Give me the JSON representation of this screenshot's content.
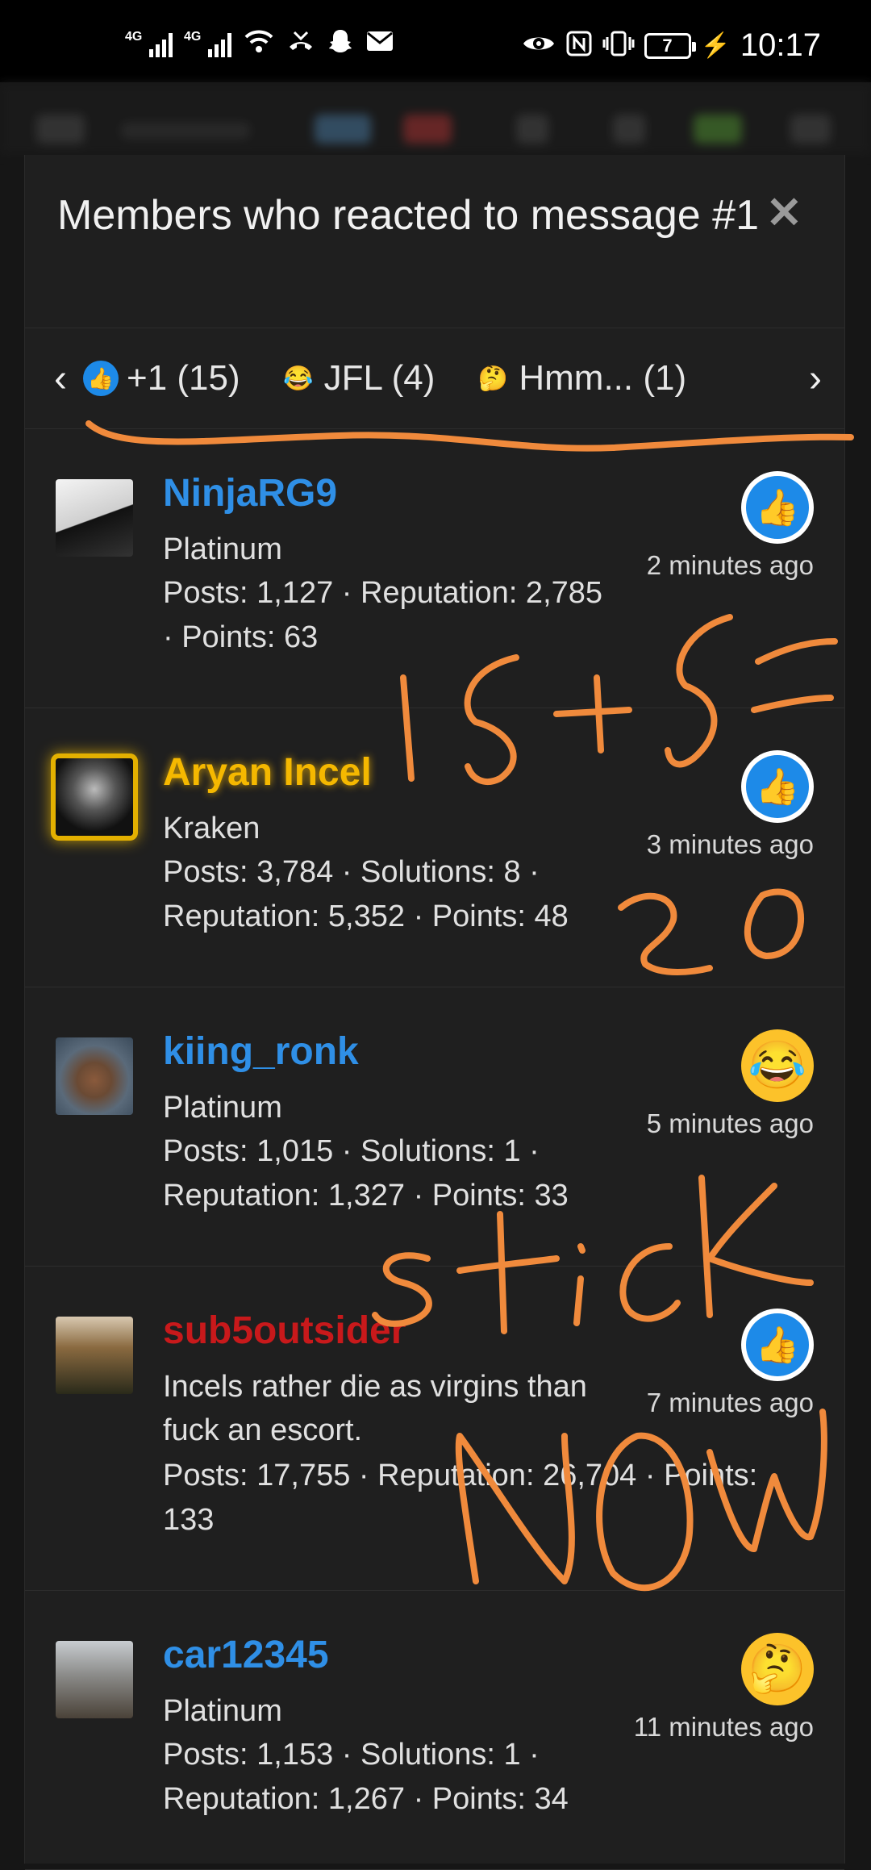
{
  "status": {
    "network1": "4G",
    "network2": "4G",
    "battery": "7",
    "time": "10:17"
  },
  "modal": {
    "title": "Members who reacted to message #1",
    "close_icon": "close-icon"
  },
  "tabs": [
    {
      "icon": "like-icon",
      "label": "+1 (15)"
    },
    {
      "icon": "tears-of-joy-icon",
      "label": "JFL (4)"
    },
    {
      "icon": "thinking-icon",
      "label": "Hmm... (1)"
    }
  ],
  "members": [
    {
      "name": "NinjaRG9",
      "name_color": "#2f8fe6",
      "title": "Platinum",
      "stats": "Posts: 1,127 · Reputation: 2,785 · Points: 63",
      "reaction": "like",
      "time": "2 minutes ago"
    },
    {
      "name": "Aryan Incel",
      "name_color": "#f5b800",
      "title": "Kraken",
      "stats": "Posts: 3,784 · Solutions: 8 · Reputation: 5,352 · Points: 48",
      "reaction": "like",
      "time": "3 minutes ago"
    },
    {
      "name": "kiing_ronk",
      "name_color": "#2f8fe6",
      "title": "Platinum",
      "stats": "Posts: 1,015 · Solutions: 1 · Reputation: 1,327 · Points: 33",
      "reaction": "tears-of-joy",
      "time": "5 minutes ago"
    },
    {
      "name": "sub5outsider",
      "name_color": "#c8191b",
      "title": "Incels rather die as virgins than fuck an escort.",
      "stats": "Posts: 17,755 · Reputation: 26,704 · Points: 133",
      "reaction": "like",
      "time": "7 minutes ago"
    },
    {
      "name": "car12345",
      "name_color": "#2f8fe6",
      "title": "Platinum",
      "stats": "Posts: 1,153 · Solutions: 1 · Reputation: 1,267 · Points: 34",
      "reaction": "thinking",
      "time": "11 minutes ago"
    }
  ],
  "handwriting": {
    "line1": "15+5=",
    "line2": "20",
    "line3": "stick",
    "line4": "NOW",
    "color": "#f08a3c"
  }
}
